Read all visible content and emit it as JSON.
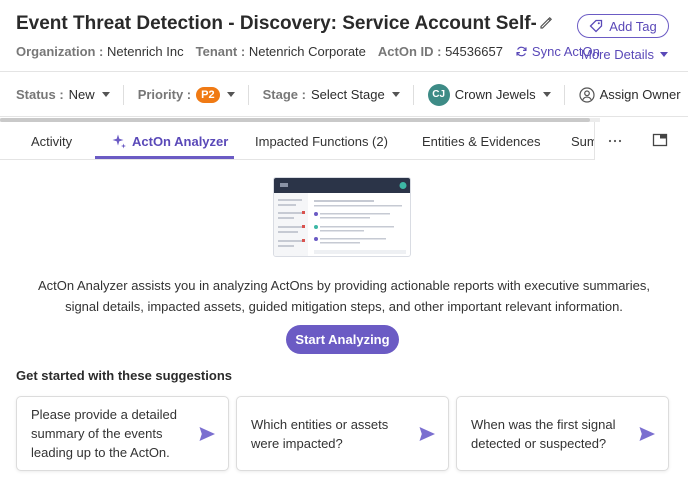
{
  "header": {
    "title": "Event Threat Detection - Discovery: Service Account Self-Inves…",
    "add_tag_label": "Add Tag",
    "organization_label": "Organization :",
    "organization_value": "Netenrich Inc",
    "tenant_label": "Tenant :",
    "tenant_value": "Netenrich Corporate",
    "acton_id_label": "ActOn ID :",
    "acton_id_value": "54536657",
    "sync_label": "Sync ActOn",
    "more_details_label": "More Details"
  },
  "filters": {
    "status_label": "Status :",
    "status_value": "New",
    "priority_label": "Priority :",
    "priority_value": "P2",
    "stage_label": "Stage :",
    "stage_value": "Select Stage",
    "crown_initials": "CJ",
    "crown_label": "Crown Jewels",
    "assign_label": "Assign Owner"
  },
  "tabs": [
    {
      "label": "Activity"
    },
    {
      "label": "ActOn Analyzer"
    },
    {
      "label": "Impacted Functions (2)"
    },
    {
      "label": "Entities & Evidences"
    },
    {
      "label": "Sum"
    }
  ],
  "analyzer": {
    "description": "ActOn Analyzer assists you in analyzing ActOns by providing actionable reports with executive summaries, signal details, impacted assets, guided mitigation steps, and other important relevant information.",
    "start_label": "Start Analyzing",
    "suggestions_title": "Get started with these suggestions",
    "suggestions": [
      {
        "text": "Please provide a detailed summary of the events leading up to the ActOn."
      },
      {
        "text": "Which entities or assets were impacted?"
      },
      {
        "text": "When was the first signal detected or suspected?"
      }
    ]
  },
  "colors": {
    "accent": "#6b5bc4",
    "priority_p2": "#f07a14",
    "crown_avatar": "#3d8b86"
  }
}
